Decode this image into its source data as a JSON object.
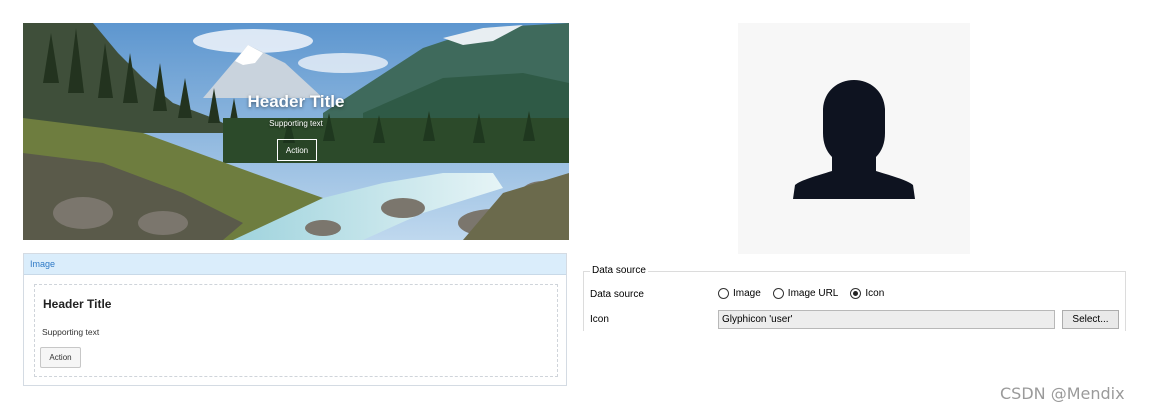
{
  "hero": {
    "title": "Header Title",
    "subtitle": "Supporting text",
    "button_label": "Action"
  },
  "structure": {
    "header_label": "Image",
    "title": "Header Title",
    "subtitle": "Supporting text",
    "button_label": "Action"
  },
  "avatar": {
    "icon": "user-icon",
    "fill_color": "#0e1320",
    "background": "#f7f7f7"
  },
  "data_source": {
    "legend": "Data source",
    "row_label": "Data source",
    "options": [
      "Image",
      "Image URL",
      "Icon"
    ],
    "selected": "Icon",
    "icon_label": "Icon",
    "icon_value": "Glyphicon 'user'",
    "select_button": "Select..."
  },
  "watermark": "CSDN @Mendix",
  "colors": {
    "accent": "#2f7ac6",
    "header_bg": "#daedfb"
  }
}
